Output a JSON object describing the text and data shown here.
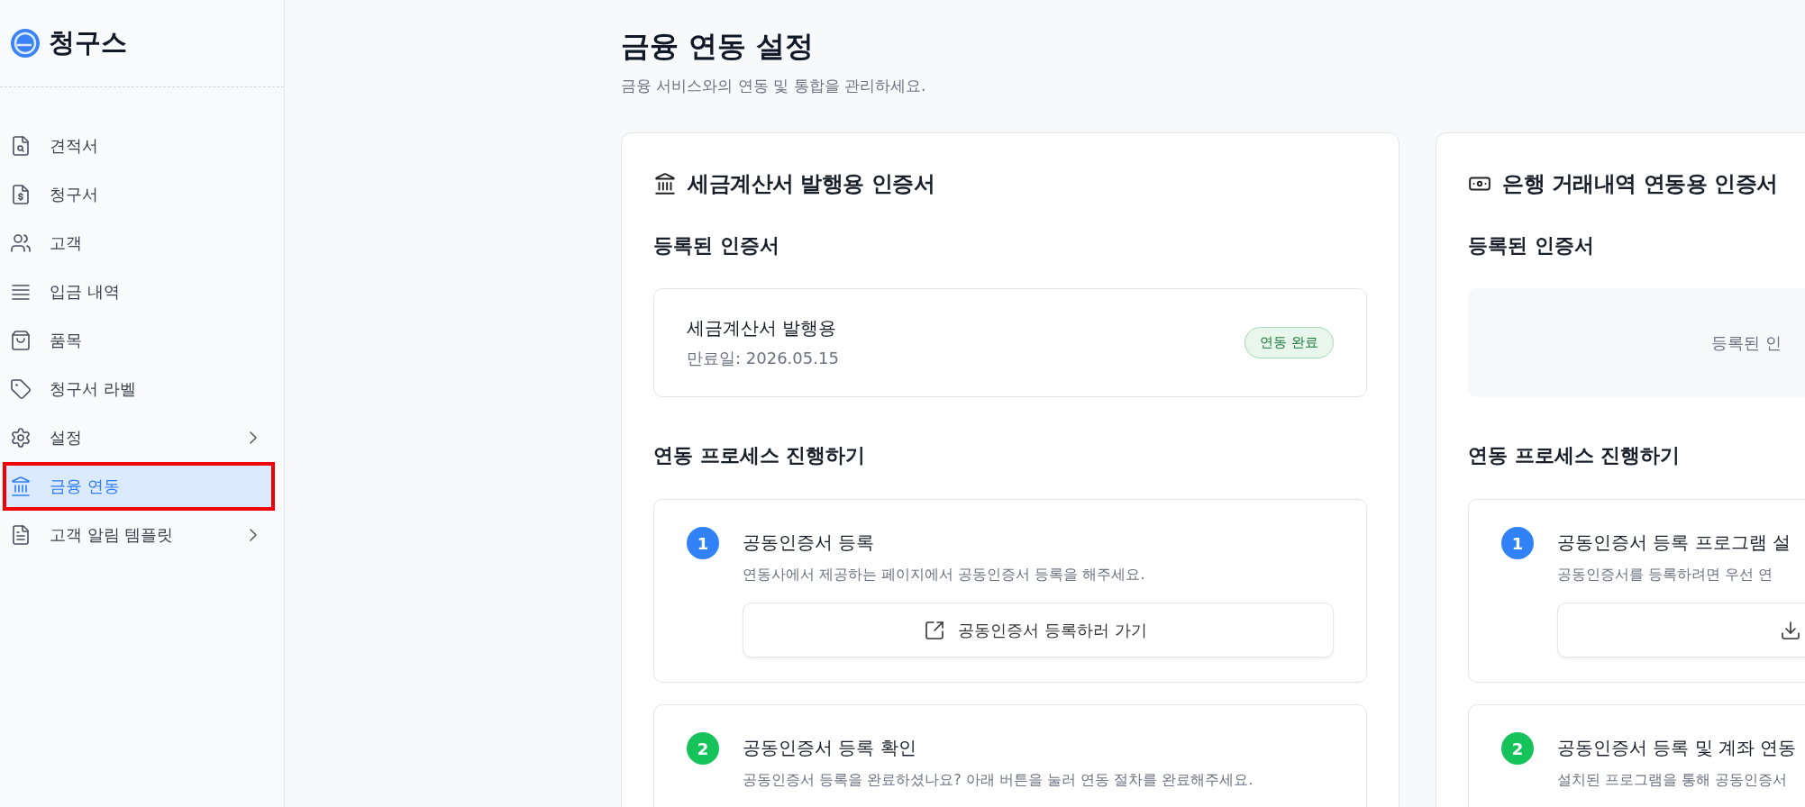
{
  "sidebar": {
    "logo": "청구스",
    "items": [
      {
        "label": "견적서",
        "selected": false,
        "has_children": false
      },
      {
        "label": "청구서",
        "selected": false,
        "has_children": false
      },
      {
        "label": "고객",
        "selected": false,
        "has_children": false
      },
      {
        "label": "입금 내역",
        "selected": false,
        "has_children": false
      },
      {
        "label": "품목",
        "selected": false,
        "has_children": false
      },
      {
        "label": "청구서 라벨",
        "selected": false,
        "has_children": false
      },
      {
        "label": "설정",
        "selected": false,
        "has_children": true
      },
      {
        "label": "금융 연동",
        "selected": true,
        "has_children": false
      },
      {
        "label": "고객 알림 템플릿",
        "selected": false,
        "has_children": true
      }
    ]
  },
  "page": {
    "title": "금융 연동 설정",
    "subtitle": "금융 서비스와의 연동 및 통합을 관리하세요."
  },
  "cards": [
    {
      "title": "세금계산서 발행용 인증서",
      "registered_heading": "등록된 인증서",
      "registered": {
        "kind": "cert",
        "name": "세금계산서 발행용",
        "expiry": "만료일: 2026.05.15",
        "badge": "연동 완료"
      },
      "process_heading": "연동 프로세스 진행하기",
      "steps": [
        {
          "number": "1",
          "color": "#3182f6",
          "title": "공동인증서 등록",
          "description": "연동사에서 제공하는 페이지에서 공동인증서 등록을 해주세요.",
          "has_button": true,
          "button_label": "공동인증서 등록하러 가기"
        },
        {
          "number": "2",
          "color": "#16c35a",
          "title": "공동인증서 등록 확인",
          "description": "공동인증서 등록을 완료하셨나요? 아래 버튼을 눌러 연동 절차를 완료해주세요."
        }
      ]
    },
    {
      "title": "은행 거래내역 연동용 인증서",
      "registered_heading": "등록된 인증서",
      "registered": {
        "kind": "empty",
        "message": "등록된 인"
      },
      "process_heading": "연동 프로세스 진행하기",
      "steps": [
        {
          "number": "1",
          "color": "#3182f6",
          "title": "공동인증서 등록 프로그램 설",
          "description": "공동인증서를 등록하려면 우선 연",
          "has_button": true
        },
        {
          "number": "2",
          "color": "#16c35a",
          "title": "공동인증서 등록 및 계좌 연동",
          "description": "설치된 프로그램을 통해 공동인증서"
        }
      ]
    }
  ]
}
